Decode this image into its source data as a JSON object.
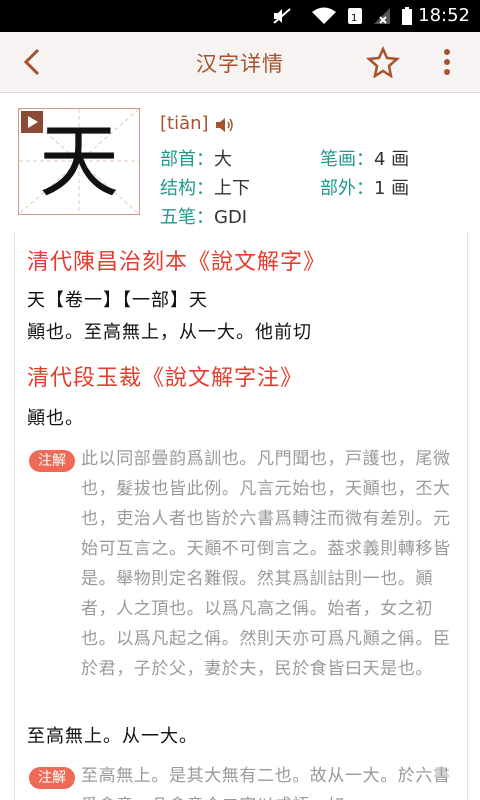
{
  "status_bar": {
    "time": "18:52"
  },
  "app_bar": {
    "title": "汉字详情",
    "icons": [
      "back-icon",
      "star-icon",
      "more-vertical-icon"
    ]
  },
  "character": {
    "glyph": "天",
    "pinyin": "[tiān]",
    "fields": {
      "radical_label": "部首：",
      "radical_value": "大",
      "strokes_label": "笔画：",
      "strokes_value": "4 画",
      "structure_label": "结构：",
      "structure_value": "上下",
      "outside_label": "部外：",
      "outside_value": "1 画",
      "wubi_label": "五笔：",
      "wubi_value": "GDI"
    }
  },
  "content": {
    "section1": {
      "heading": "清代陳昌治刻本《說文解字》",
      "line1": "天【卷一】【一部】天",
      "line2": "顚也。至高無上，从一大。他前切"
    },
    "section2": {
      "heading": "清代段玉裁《說文解字注》",
      "line1": "顚也。",
      "badge1": "注解",
      "note1": "此以同部曡韵爲訓也。凡門聞也，戸護也，尾微也，髮拔也皆此例。凡言元始也，天顚也，丕大也，吏治人者也皆於六書爲轉注而微有差別。元始可互言之。天顚不可倒言之。葢求義則轉移皆是。舉物則定名難假。然其爲訓詁則一也。顚者，人之頂也。以爲凡高之偁。始者，女之初也。以爲凡起之偁。然則天亦可爲凡顚之偁。臣於君，子於父，妻於夫，民於食皆曰天是也。",
      "line2": "至高無上。从一大。",
      "badge2": "注解",
      "note2": "至高無上。是其大無有二也。故从一大。於六書爲會意。凡會意合二字以成語，如"
    }
  }
}
